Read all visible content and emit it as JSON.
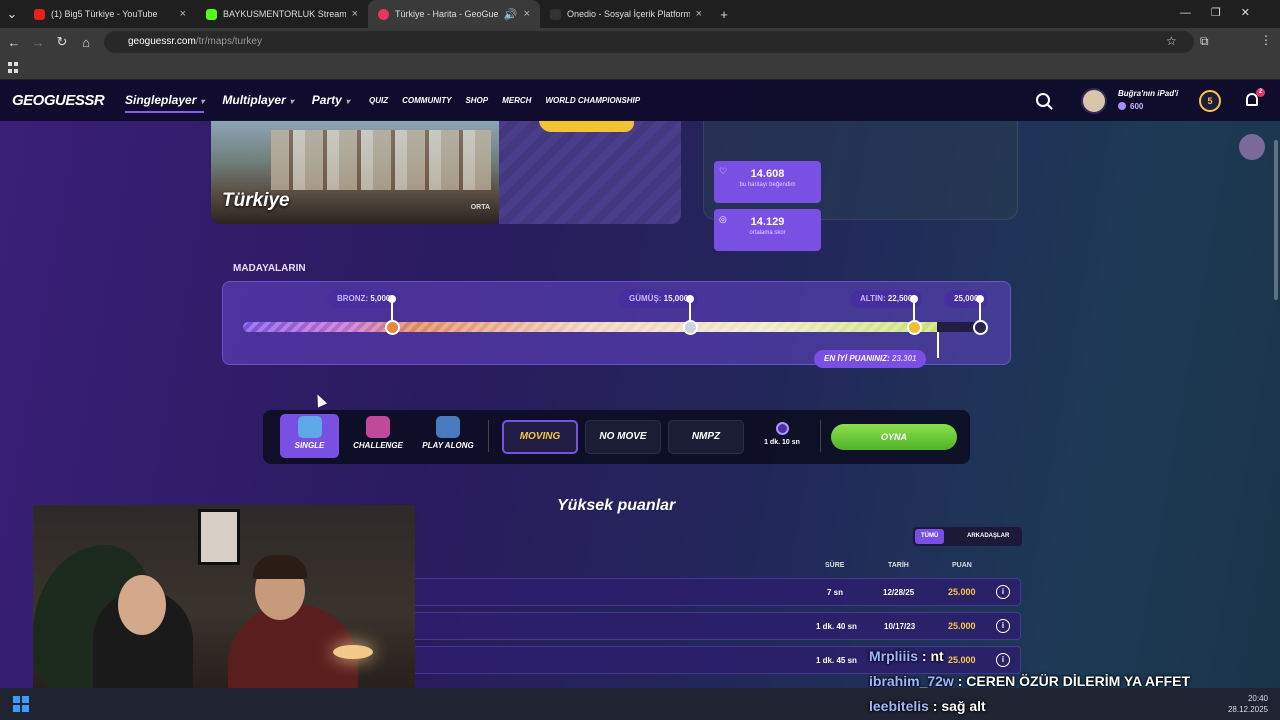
{
  "browser": {
    "tabs": [
      {
        "title": "(1) Big5 Türkiye - YouTube",
        "color": "#e62117"
      },
      {
        "title": "BAYKUSMENTORLUK Stream - ",
        "color": "#53fc18"
      },
      {
        "title": "Türkiye - Harita - GeoGuess",
        "color": "#e8365c"
      },
      {
        "title": "Onedio - Sosyal İçerik Platform",
        "color": "#333333"
      }
    ],
    "url_host": "geoguessr.com",
    "url_path": "/tr/maps/turkey"
  },
  "header": {
    "logo": "GEOGUESSR",
    "nav": [
      "Singleplayer",
      "Multiplayer",
      "Party"
    ],
    "subnav": [
      "QUIZ",
      "COMMUNITY",
      "SHOP",
      "MERCH",
      "WORLD CHAMPIONSHIP"
    ],
    "username": "Buğra'nın iPad'i",
    "coins": "600",
    "level": "5",
    "notifications": "2"
  },
  "map": {
    "name": "Türkiye",
    "difficulty": "ORTA",
    "stats": [
      {
        "value": "14.608",
        "label": "bu haritayı beğendim"
      },
      {
        "value": "14.129",
        "label": "ortalama skor"
      }
    ]
  },
  "medals": {
    "title": "MADAYALARIN",
    "markers": [
      {
        "label": "BRONZ:",
        "value": "5,000",
        "score": 5000,
        "color": "#e8883a"
      },
      {
        "label": "GÜMÜŞ:",
        "value": "15,000",
        "score": 15000,
        "color": "#cfd0e0"
      },
      {
        "label": "ALTIN:",
        "value": "22,500",
        "score": 22500,
        "color": "#f0c030"
      },
      {
        "label": "",
        "value": "25,000",
        "score": 25000,
        "color": "#2a2550"
      }
    ],
    "max": 25000,
    "best_label": "EN İYİ PUANINIZ:",
    "best_value": "23.301",
    "best_score": 23301
  },
  "modes": {
    "items": [
      "SINGLE",
      "CHALLENGE",
      "PLAY ALONG"
    ],
    "movement": [
      "MOVING",
      "NO MOVE",
      "NMPZ"
    ],
    "timer": "1 dk. 10 sn",
    "play": "OYNA"
  },
  "highscores": {
    "title": "Yüksek puanlar",
    "tabs": [
      "TÜMÜ",
      "ARKADAŞLAR"
    ],
    "columns": [
      "SÜRE",
      "TARİH",
      "PUAN"
    ],
    "rows": [
      {
        "time": "7 sn",
        "date": "12/28/25",
        "points": "25.000"
      },
      {
        "time": "1 dk. 40 sn",
        "date": "10/17/23",
        "points": "25.000"
      },
      {
        "time": "1 dk. 45 sn",
        "date": "",
        "points": "25.000"
      }
    ]
  },
  "chat": [
    {
      "user": "Mrpliiis",
      "msg": " : nt"
    },
    {
      "user": "ibrahim_72w",
      "msg": " : CEREN ÖZÜR DİLERİM YA AFFET"
    },
    {
      "user": "leebitelis",
      "msg": " : sağ alt"
    }
  ],
  "taskbar": {
    "time": "20:40",
    "date": "28.12.2025"
  }
}
